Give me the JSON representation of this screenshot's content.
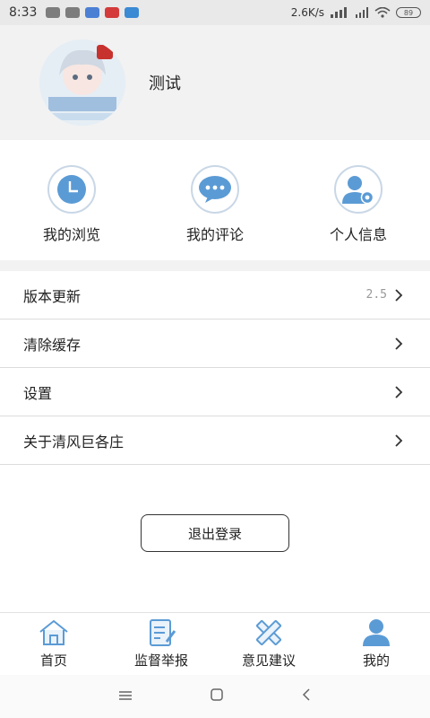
{
  "status_bar": {
    "time": "8:33",
    "network_speed": "2.6K/s",
    "battery": "89"
  },
  "profile": {
    "username": "测试"
  },
  "quick_actions": [
    {
      "label": "我的浏览",
      "icon": "clock-icon"
    },
    {
      "label": "我的评论",
      "icon": "comment-bubble-icon"
    },
    {
      "label": "个人信息",
      "icon": "user-settings-icon"
    }
  ],
  "menu": [
    {
      "label": "版本更新",
      "value": "2.5"
    },
    {
      "label": "清除缓存",
      "value": ""
    },
    {
      "label": "设置",
      "value": ""
    },
    {
      "label": "关于清风巨各庄",
      "value": ""
    }
  ],
  "logout_label": "退出登录",
  "tabs": [
    {
      "label": "首页",
      "icon": "home-icon"
    },
    {
      "label": "监督举报",
      "icon": "report-icon"
    },
    {
      "label": "意见建议",
      "icon": "pencil-ruler-icon"
    },
    {
      "label": "我的",
      "icon": "user-icon",
      "active": true
    }
  ],
  "colors": {
    "accent": "#5b9bd5",
    "header_bg": "#f2f2f2",
    "divider": "#dcdcdc"
  }
}
